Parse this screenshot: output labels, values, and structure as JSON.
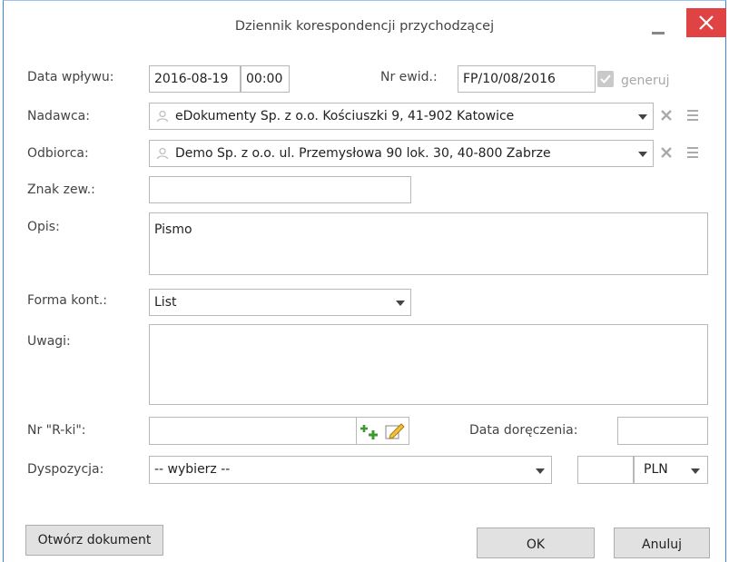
{
  "window": {
    "title": "Dziennik korespondencji przychodzącej"
  },
  "form": {
    "data_wplywu": {
      "label": "Data wpływu:",
      "date": "2016-08-19",
      "time": "00:00"
    },
    "nr_ewid": {
      "label": "Nr ewid.:",
      "value": "FP/10/08/2016",
      "generate_label": "generuj",
      "generate_checked": true
    },
    "nadawca": {
      "label": "Nadawca:",
      "value": "eDokumenty Sp. z o.o. Kościuszki 9, 41-902 Katowice"
    },
    "odbiorca": {
      "label": "Odbiorca:",
      "value": "Demo Sp. z o.o. ul. Przemysłowa 90 lok. 30, 40-800 Zabrze"
    },
    "znak_zew": {
      "label": "Znak zew.:",
      "value": ""
    },
    "opis": {
      "label": "Opis:",
      "value": "Pismo"
    },
    "forma_kont": {
      "label": "Forma kont.:",
      "value": "List"
    },
    "uwagi": {
      "label": "Uwagi:",
      "value": ""
    },
    "nr_rki": {
      "label": "Nr \"R-ki\":",
      "value": ""
    },
    "data_doreczenia": {
      "label": "Data doręczenia:",
      "value": ""
    },
    "dyspozycja": {
      "label": "Dyspozycja:",
      "value": "-- wybierz --",
      "amount": "",
      "currency": "PLN"
    }
  },
  "buttons": {
    "open_document": "Otwórz dokument",
    "ok": "OK",
    "cancel": "Anuluj"
  },
  "colors": {
    "close_button": "#e04343",
    "field_border": "#b8b8b8",
    "button_bg": "#e1e1e1"
  }
}
